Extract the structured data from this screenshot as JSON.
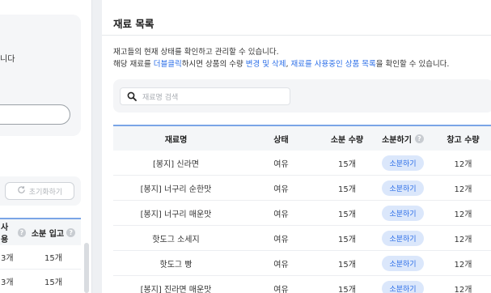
{
  "left_panel": {
    "partial_text": "니다",
    "reset_button_label": "초기화하기",
    "table": {
      "headers": [
        "사용",
        "소분 입고"
      ],
      "rows": [
        [
          "3개",
          "15개"
        ],
        [
          "3개",
          "15개"
        ]
      ]
    }
  },
  "main": {
    "title": "재료 목록",
    "description_line1": "재고들의 현재 상태를 확인하고 관리할 수 있습니다.",
    "description_line2_parts": {
      "prefix": "해당 재료를 ",
      "dblclick": "더블클릭",
      "mid": "하시면 상품의 수량 ",
      "edit": "변경 및 삭제",
      "sep": ", ",
      "usage": "재료를 사용중인 상품 목록",
      "suffix": "을 확인할 수 있습니다."
    },
    "search": {
      "placeholder": "재료명 검색"
    },
    "table": {
      "headers": {
        "name": "재료명",
        "status": "상태",
        "qty": "소분 수량",
        "portion": "소분하기",
        "stock": "창고 수량"
      },
      "portion_button_label": "소분하기",
      "rows": [
        {
          "name": "[봉지] 신라면",
          "status": "여유",
          "qty": "15개",
          "stock": "12개"
        },
        {
          "name": "[봉지] 너구리 순한맛",
          "status": "여유",
          "qty": "15개",
          "stock": "12개"
        },
        {
          "name": "[봉지] 너구리 매운맛",
          "status": "여유",
          "qty": "15개",
          "stock": "12개"
        },
        {
          "name": "핫도그 소세지",
          "status": "여유",
          "qty": "15개",
          "stock": "12개"
        },
        {
          "name": "핫도그 빵",
          "status": "여유",
          "qty": "15개",
          "stock": "12개"
        },
        {
          "name": "[봉지] 진라면 매운맛",
          "status": "여유",
          "qty": "15개",
          "stock": "12개"
        }
      ]
    }
  },
  "colors": {
    "accent": "#2b6ee8",
    "pill_bg": "#dbe7fb",
    "table_border": "#7aa5e6"
  }
}
